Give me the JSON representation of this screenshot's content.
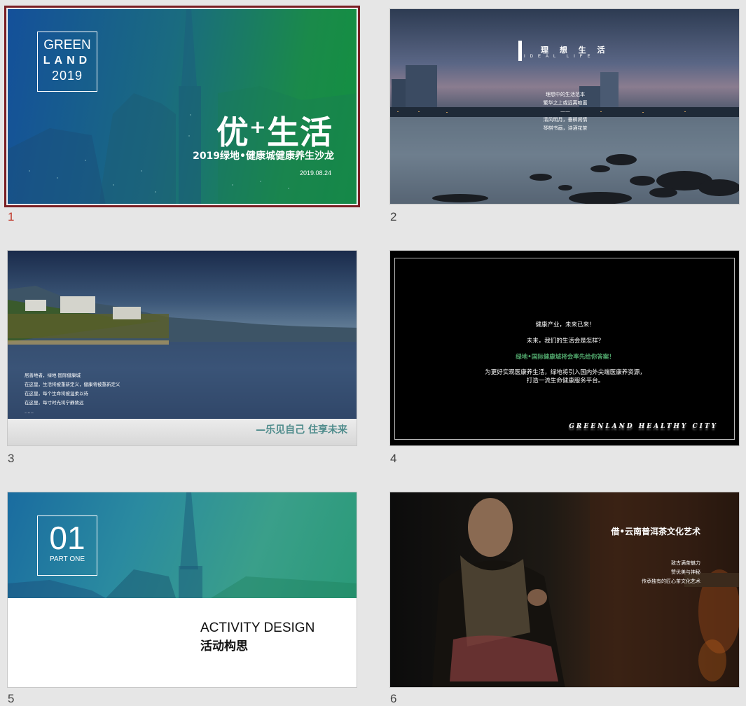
{
  "slides": [
    {
      "number": "1",
      "box_line1": "GREEN",
      "box_line2": "LAND",
      "box_line3": "2019",
      "title": "优⁺生活",
      "subtitle": "2019绿地•健康城健康养生沙龙",
      "date": "2019.08.24"
    },
    {
      "number": "2",
      "title": "理 想 生 活",
      "title_en": "IDEAL LIFE",
      "lines": [
        "理想中的生活范本",
        "繁华之上或远离喧嚣",
        "——",
        "清风明月，垂柳闲情",
        "琴棋书画，诗酒花茶"
      ]
    },
    {
      "number": "3",
      "lines": [
        "居善地者，绿地·国际健康城",
        "在这里，生活将被重新定义，健康将被重新定义",
        "在这里，每个生命将被温柔以待",
        "在这里，每寸时光将宁静致远",
        "……"
      ],
      "slogan": "—乐见自己 住享未来"
    },
    {
      "number": "4",
      "line1": "健康产业，未来已来！",
      "line2": "未来，我们的生活会是怎样？",
      "line3": "绿地•国际健康城将会率先给你答案！",
      "line4a": "为更好实现医康养生活，绿地将引入国内外尖端医康养资源，",
      "line4b": "打造一流生命健康服务平台。",
      "brand": "GREENLAND HEALTHY CITY"
    },
    {
      "number": "5",
      "box_number": "01",
      "box_label": "PART ONE",
      "title_en": "ACTIVITY DESIGN",
      "title_cn": "活动构思"
    },
    {
      "number": "6",
      "title": "借•云南普洱茶文化艺术",
      "lines": [
        "致古满茶魅力",
        "赞优美与神秘",
        "传承独有的匠心茶文化艺术"
      ]
    }
  ],
  "colors": {
    "selection_outline": "#7a1f24",
    "selected_number": "#c0392b",
    "panel_background": "#e6e6e6",
    "slogan_teal": "#4f8c8c",
    "highlight_green": "#4fa46a"
  }
}
